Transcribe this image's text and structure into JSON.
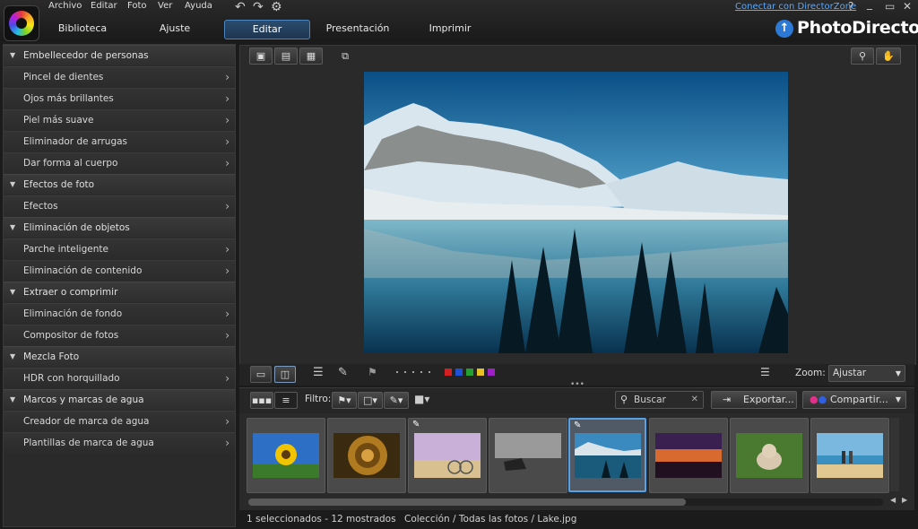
{
  "menu": [
    "Archivo",
    "Editar",
    "Foto",
    "Ver",
    "Ayuda"
  ],
  "toolbar_icons": {
    "undo": "↶",
    "redo": "↷",
    "settings": "⚙"
  },
  "nav_tabs": [
    "Biblioteca",
    "Ajuste",
    "Editar",
    "Presentación",
    "Imprimir"
  ],
  "connect_link": "Conectar con DirectorZone",
  "window_buttons": [
    "?",
    "_",
    "▭",
    "✕"
  ],
  "brand": {
    "name": "PhotoDirector",
    "accent": "#2d7ad6"
  },
  "sidebar": {
    "sections": [
      {
        "title": "Embellecedor de personas",
        "items": [
          "Pincel de dientes",
          "Ojos más brillantes",
          "Piel más suave",
          "Eliminador de arrugas",
          "Dar forma al cuerpo"
        ]
      },
      {
        "title": "Efectos de foto",
        "items": [
          "Efectos"
        ]
      },
      {
        "title": "Eliminación de objetos",
        "items": [
          "Parche inteligente",
          "Eliminación de contenido"
        ]
      },
      {
        "title": "Extraer o comprimir",
        "items": [
          "Eliminación de fondo",
          "Compositor de fotos"
        ]
      },
      {
        "title": "Mezcla Foto",
        "items": [
          "HDR con horquillado"
        ]
      },
      {
        "title": "Marcos y marcas de agua",
        "items": [
          "Creador de marca de agua",
          "Plantillas de marca de agua"
        ]
      }
    ]
  },
  "viewer_tools": {
    "zoom_label": "Zoom:",
    "zoom_value": "Ajustar"
  },
  "color_labels": [
    "#d42020",
    "#2050d8",
    "#23a030",
    "#e8c020",
    "#a020c8"
  ],
  "filmstrip": {
    "filter_label": "Filtro:",
    "search_placeholder": "Buscar",
    "export_label": "Exportar...",
    "share_label": "Compartir..."
  },
  "status": {
    "count": "1 seleccionados - 12 mostrados",
    "path": "Colección / Todas las fotos / Lake.jpg"
  }
}
